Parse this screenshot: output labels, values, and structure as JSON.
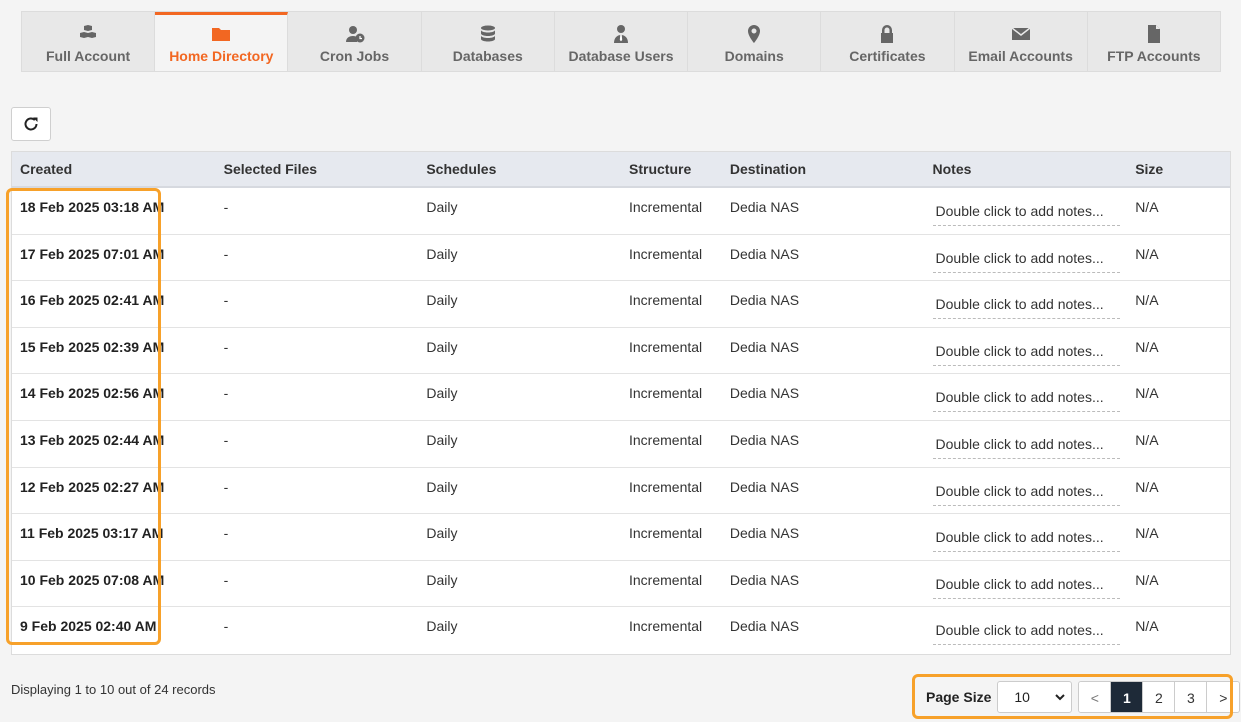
{
  "tabs": [
    {
      "label": "Full Account",
      "icon": "cubes-icon",
      "active": false
    },
    {
      "label": "Home Directory",
      "icon": "folder-icon",
      "active": true
    },
    {
      "label": "Cron Jobs",
      "icon": "user-clock-icon",
      "active": false
    },
    {
      "label": "Databases",
      "icon": "database-icon",
      "active": false
    },
    {
      "label": "Database Users",
      "icon": "user-tie-icon",
      "active": false
    },
    {
      "label": "Domains",
      "icon": "map-marker-icon",
      "active": false
    },
    {
      "label": "Certificates",
      "icon": "lock-icon",
      "active": false
    },
    {
      "label": "Email Accounts",
      "icon": "envelope-icon",
      "active": false
    },
    {
      "label": "FTP Accounts",
      "icon": "file-icon",
      "active": false
    }
  ],
  "colors": {
    "accent": "#f26722",
    "highlight": "#f7a12a",
    "active_page": "#1e2a38"
  },
  "table": {
    "headers": [
      "Created",
      "Selected Files",
      "Schedules",
      "Structure",
      "Destination",
      "Notes",
      "Size"
    ],
    "rows": [
      {
        "created": "18 Feb 2025 03:18 AM",
        "files": "-",
        "schedule": "Daily",
        "structure": "Incremental",
        "destination": "Dedia NAS",
        "notes": "Double click to add notes...",
        "size": "N/A"
      },
      {
        "created": "17 Feb 2025 07:01 AM",
        "files": "-",
        "schedule": "Daily",
        "structure": "Incremental",
        "destination": "Dedia NAS",
        "notes": "Double click to add notes...",
        "size": "N/A"
      },
      {
        "created": "16 Feb 2025 02:41 AM",
        "files": "-",
        "schedule": "Daily",
        "structure": "Incremental",
        "destination": "Dedia NAS",
        "notes": "Double click to add notes...",
        "size": "N/A"
      },
      {
        "created": "15 Feb 2025 02:39 AM",
        "files": "-",
        "schedule": "Daily",
        "structure": "Incremental",
        "destination": "Dedia NAS",
        "notes": "Double click to add notes...",
        "size": "N/A"
      },
      {
        "created": "14 Feb 2025 02:56 AM",
        "files": "-",
        "schedule": "Daily",
        "structure": "Incremental",
        "destination": "Dedia NAS",
        "notes": "Double click to add notes...",
        "size": "N/A"
      },
      {
        "created": "13 Feb 2025 02:44 AM",
        "files": "-",
        "schedule": "Daily",
        "structure": "Incremental",
        "destination": "Dedia NAS",
        "notes": "Double click to add notes...",
        "size": "N/A"
      },
      {
        "created": "12 Feb 2025 02:27 AM",
        "files": "-",
        "schedule": "Daily",
        "structure": "Incremental",
        "destination": "Dedia NAS",
        "notes": "Double click to add notes...",
        "size": "N/A"
      },
      {
        "created": "11 Feb 2025 03:17 AM",
        "files": "-",
        "schedule": "Daily",
        "structure": "Incremental",
        "destination": "Dedia NAS",
        "notes": "Double click to add notes...",
        "size": "N/A"
      },
      {
        "created": "10 Feb 2025 07:08 AM",
        "files": "-",
        "schedule": "Daily",
        "structure": "Incremental",
        "destination": "Dedia NAS",
        "notes": "Double click to add notes...",
        "size": "N/A"
      },
      {
        "created": "9 Feb 2025 02:40 AM",
        "files": "-",
        "schedule": "Daily",
        "structure": "Incremental",
        "destination": "Dedia NAS",
        "notes": "Double click to add notes...",
        "size": "N/A"
      }
    ]
  },
  "footer": {
    "records_text": "Displaying 1 to 10 out of 24 records",
    "page_size_label": "Page Size",
    "page_size_value": "10",
    "prev": "<",
    "next": ">",
    "pages": [
      "1",
      "2",
      "3"
    ],
    "current_page": "1"
  }
}
